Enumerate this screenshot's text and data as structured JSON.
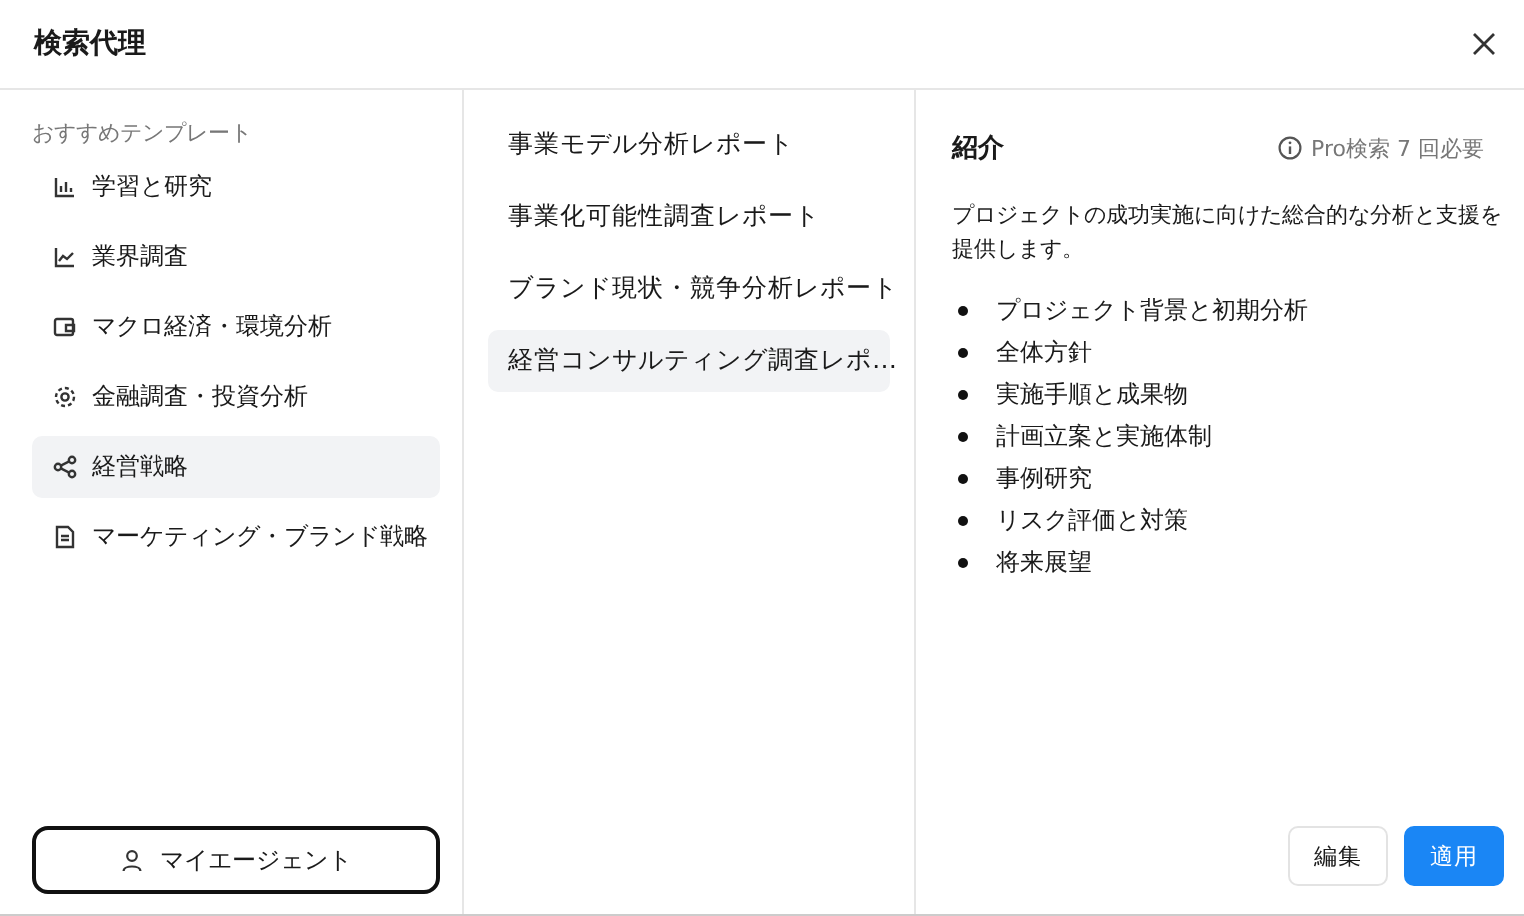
{
  "window": {
    "title": "検索代理"
  },
  "sidebar": {
    "heading": "おすすめテンプレート",
    "items": [
      {
        "label": "学習と研究",
        "selected": false
      },
      {
        "label": "業界調査",
        "selected": false
      },
      {
        "label": "マクロ経済・環境分析",
        "selected": false
      },
      {
        "label": "金融調査・投資分析",
        "selected": false
      },
      {
        "label": "経営戦略",
        "selected": true
      },
      {
        "label": "マーケティング・ブランド戦略",
        "selected": false
      }
    ],
    "my_agent_button": "マイエージェント"
  },
  "templates": [
    {
      "label": "事業モデル分析レポート",
      "selected": false
    },
    {
      "label": "事業化可能性調査レポート",
      "selected": false
    },
    {
      "label": "ブランド現状・競争分析レポート",
      "selected": false
    },
    {
      "label": "経営コンサルティング調査レポ…",
      "selected": true
    }
  ],
  "detail": {
    "heading": "紹介",
    "cost": "Pro検索 7 回必要",
    "description": "プロジェクトの成功実施に向けた総合的な分析と支援を提供します。",
    "bullets": [
      "プロジェクト背景と初期分析",
      "全体方針",
      "実施手順と成果物",
      "計画立案と実施体制",
      "事例研究",
      "リスク評価と対策",
      "将来展望"
    ],
    "buttons": [
      "編集",
      "適用"
    ]
  }
}
